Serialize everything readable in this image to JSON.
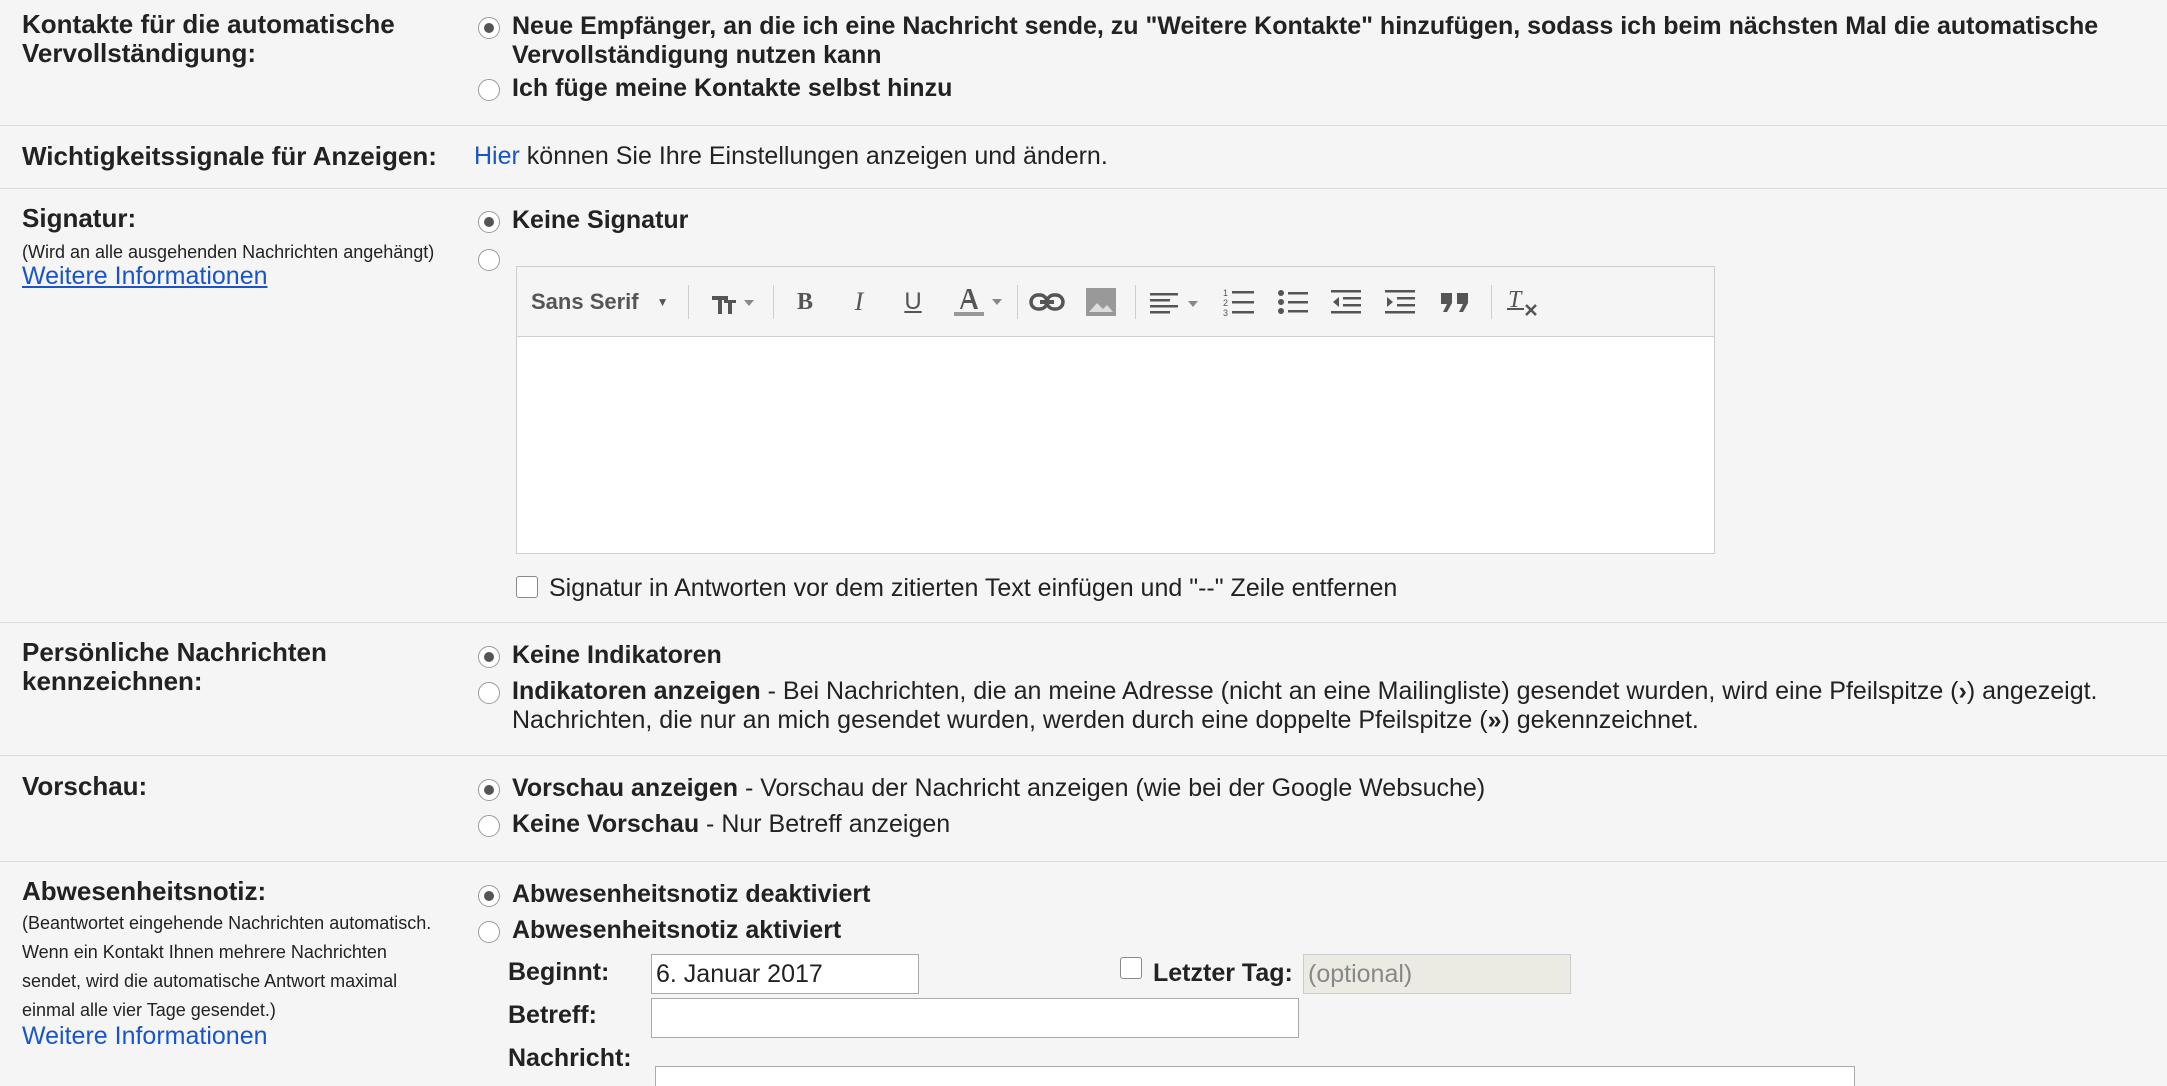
{
  "autocomplete": {
    "label_line1": "Kontakte für die automatische",
    "label_line2": "Vervollständigung:",
    "opt1_line1": "Neue Empfänger, an die ich eine Nachricht sende, zu \"Weitere Kontakte\" hinzufügen, sodass ich beim nächsten Mal die automatische",
    "opt1_line2": "Vervollständigung nutzen kann",
    "opt2": "Ich füge meine Kontakte selbst hinzu"
  },
  "importance": {
    "label": "Wichtigkeitssignale für Anzeigen:",
    "link": "Hier",
    "text": " können Sie Ihre Einstellungen anzeigen und ändern."
  },
  "signature": {
    "label": "Signatur:",
    "note": "(Wird an alle ausgehenden Nachrichten angehängt)",
    "more": "Weitere Informationen",
    "opt_none": "Keine Signatur",
    "font": "Sans Serif",
    "checkbox": "Signatur in Antworten vor dem zitierten Text einfügen und \"--\" Zeile entfernen"
  },
  "indicators": {
    "label_line1": "Persönliche Nachrichten",
    "label_line2": "kennzeichnen:",
    "opt_none": "Keine Indikatoren",
    "opt_show": "Indikatoren anzeigen",
    "opt_show_desc1": " - Bei Nachrichten, die an meine Adresse (nicht an eine Mailingliste) gesendet wurden, wird eine Pfeilspitze (",
    "single_arrow": "›",
    "opt_show_desc2": ") angezeigt.",
    "desc_line2a": "Nachrichten, die nur an mich gesendet wurden, werden durch eine doppelte Pfeilspitze (",
    "double_arrow": "»",
    "desc_line2b": ") gekennzeichnet."
  },
  "preview": {
    "label": "Vorschau:",
    "opt_show": "Vorschau anzeigen",
    "opt_show_desc": " - Vorschau der Nachricht anzeigen (wie bei der Google Websuche)",
    "opt_none": "Keine Vorschau",
    "opt_none_desc": " - Nur Betreff anzeigen"
  },
  "vacation": {
    "label": "Abwesenheitsnotiz:",
    "note1": "(Beantwortet eingehende Nachrichten automatisch.",
    "note2": "Wenn ein Kontakt Ihnen mehrere Nachrichten",
    "note3": "sendet, wird die automatische Antwort maximal",
    "note4": "einmal alle vier Tage gesendet.)",
    "more": "Weitere Informationen",
    "opt_off": "Abwesenheitsnotiz deaktiviert",
    "opt_on": "Abwesenheitsnotiz aktiviert",
    "start_label": "Beginnt:",
    "start_value": "6. Januar 2017",
    "last_day_label": "Letzter Tag:",
    "last_day_placeholder": "(optional)",
    "subject_label": "Betreff:",
    "message_label": "Nachricht:"
  }
}
